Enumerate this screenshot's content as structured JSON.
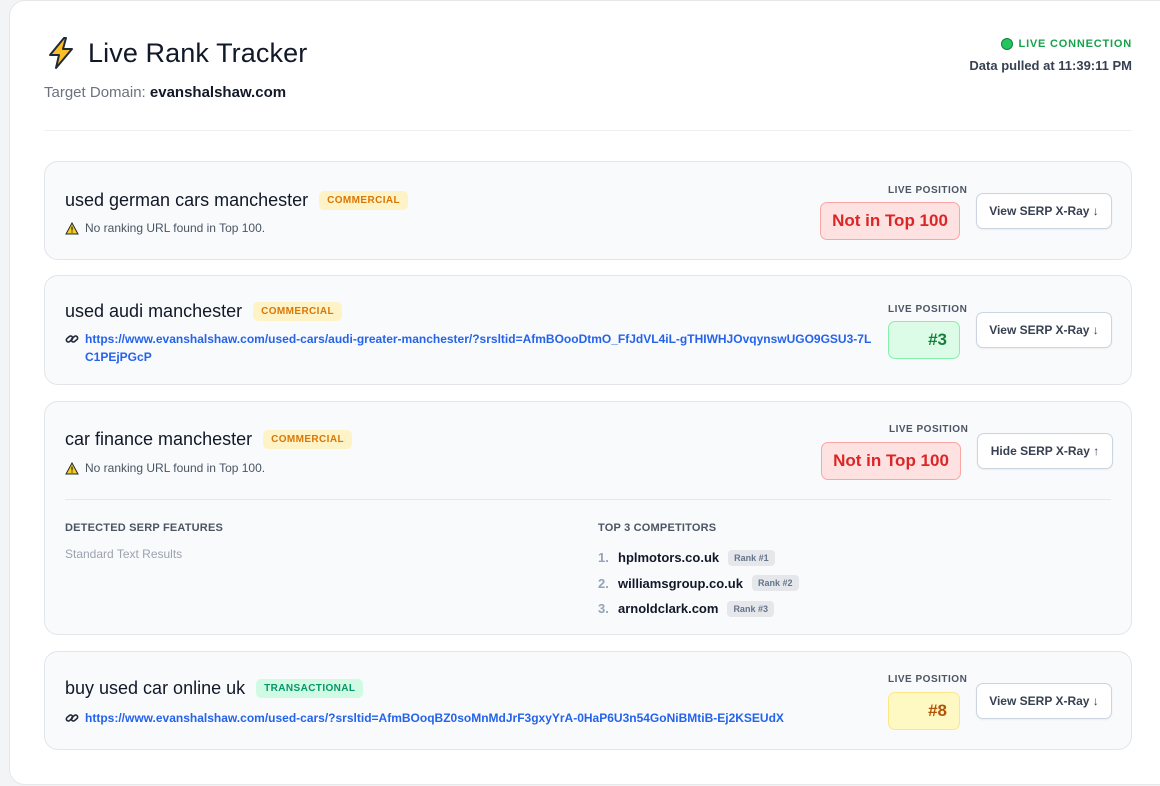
{
  "app": {
    "title": "Live Rank Tracker",
    "icon": "lightning-bolt-icon",
    "target_label": "Target Domain:",
    "target_domain": "evanshalshaw.com",
    "status": "LIVE CONNECTION",
    "pulled_at": "Data pulled at 11:39:11 PM"
  },
  "common": {
    "position_label": "LIVE POSITION"
  },
  "keywords": [
    {
      "keyword": "used german cars manchester",
      "intent": "COMMERCIAL",
      "note": "No ranking URL found in Top 100.",
      "position": "Not in Top 100",
      "button": "View SERP X-Ray ↓"
    },
    {
      "keyword": "used audi manchester",
      "intent": "COMMERCIAL",
      "url": "https://www.evanshalshaw.com/used-cars/audi-greater-manchester/?srsltid=AfmBOooDtmO_FfJdVL4iL-gTHIWHJOvqynswUGO9GSU3-7LC1PEjPGcP",
      "position": "#3",
      "button": "View SERP X-Ray ↓"
    },
    {
      "keyword": "car finance manchester",
      "intent": "COMMERCIAL",
      "note": "No ranking URL found in Top 100.",
      "position": "Not in Top 100",
      "button": "Hide SERP X-Ray ↑",
      "xray": {
        "features_title": "DETECTED SERP FEATURES",
        "features": "Standard Text Results",
        "competitors_title": "TOP 3 COMPETITORS",
        "competitors": [
          {
            "num": "1.",
            "domain": "hplmotors.co.uk",
            "rank": "Rank #1"
          },
          {
            "num": "2.",
            "domain": "williamsgroup.co.uk",
            "rank": "Rank #2"
          },
          {
            "num": "3.",
            "domain": "arnoldclark.com",
            "rank": "Rank #3"
          }
        ]
      }
    },
    {
      "keyword": "buy used car online uk",
      "intent": "TRANSACTIONAL",
      "url": "https://www.evanshalshaw.com/used-cars/?srsltid=AfmBOoqBZ0soMnMdJrF3gxyYrA-0HaP6U3n54GoNiBMtiB-Ej2KSEUdX",
      "position": "#8",
      "button": "View SERP X-Ray ↓"
    }
  ],
  "colors": {
    "live": "#22c55e",
    "link": "#2563eb",
    "bad": "#dc2626",
    "good": "#15803d",
    "mid": "#b45309"
  }
}
